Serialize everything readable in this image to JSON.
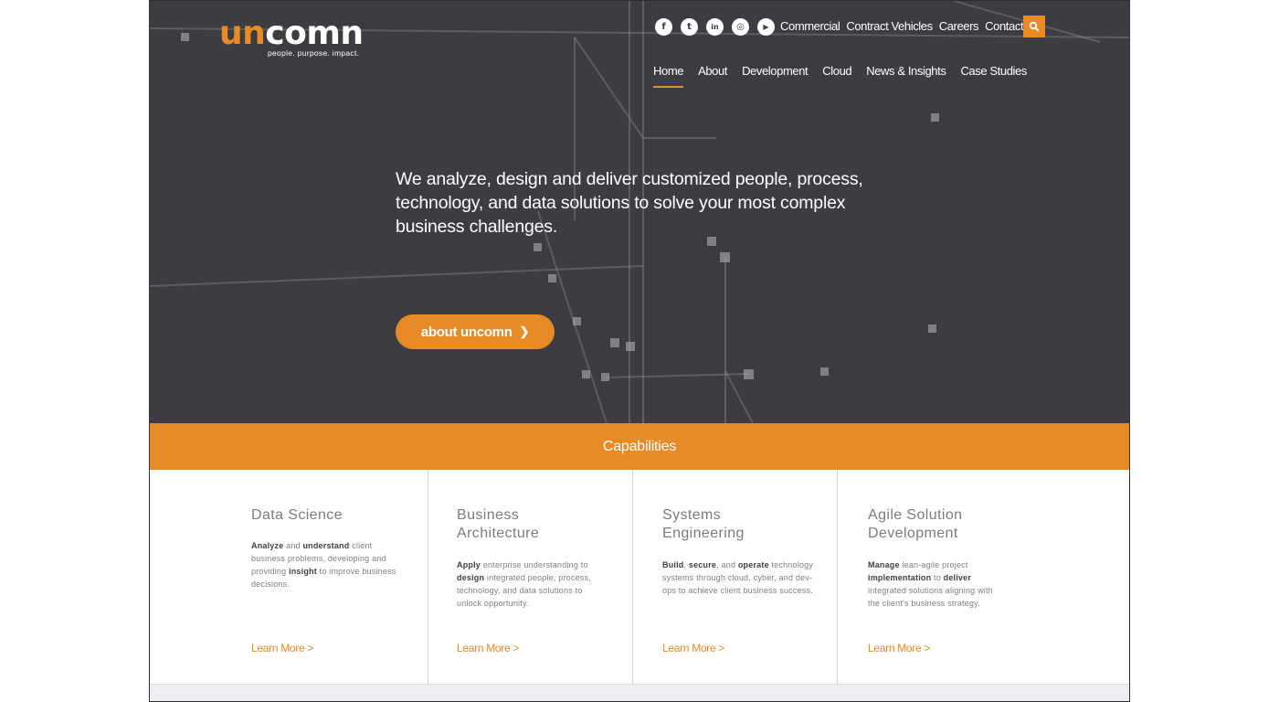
{
  "brand": {
    "logo_part1": "un",
    "logo_part2": "comn",
    "tagline": "people. purpose. impact."
  },
  "social": [
    {
      "icon": "facebook-icon",
      "glyph": "f"
    },
    {
      "icon": "twitter-icon",
      "glyph": "t"
    },
    {
      "icon": "linkedin-icon",
      "glyph": "in"
    },
    {
      "icon": "instagram-icon",
      "glyph": "◎"
    },
    {
      "icon": "youtube-icon",
      "glyph": "▶"
    }
  ],
  "util_nav": [
    "Commercial",
    "Contract Vehicles",
    "Careers",
    "Contact"
  ],
  "main_nav": [
    "Home",
    "About",
    "Development",
    "Cloud",
    "News & Insights",
    "Case Studies"
  ],
  "active_nav": "Home",
  "hero": {
    "headline": "We analyze, design and deliver customized people, process, technology, and data solutions to solve your most complex business challenges.",
    "button_label": "about uncomn",
    "button_icon": "chevron-right-icon"
  },
  "capabilities": {
    "title": "Capabilities",
    "cards": [
      {
        "title": "Data Science",
        "body_html": "<b>Analyze</b> and <b>understand</b> client business problems, developing and providing <b>insight</b> to improve business decisions.",
        "link": "Learn More >"
      },
      {
        "title": "Business Architecture",
        "body_html": "<b>Apply</b> enterprise understanding to <b>design</b> integrated people, process, technology, and data solutions to unlock opportunity.",
        "link": "Learn More >"
      },
      {
        "title": "Systems Engineering",
        "body_html": "<b>Build</b>, <b>secure</b>, and <b>operate</b> technology systems through cloud, cyber, and dev-ops to achieve client business success.",
        "link": "Learn More >"
      },
      {
        "title": "Agile Solution Development",
        "body_html": "<b>Manage</b> lean-agile project <b>implementation</b> to <b>deliver</b> integrated solutions aligning with the client's business strategy.",
        "link": "Learn More >"
      }
    ]
  },
  "colors": {
    "accent": "#e88a25",
    "hero_bg": "#3b3d42",
    "white": "#ffffff"
  },
  "search_icon": "search-icon"
}
